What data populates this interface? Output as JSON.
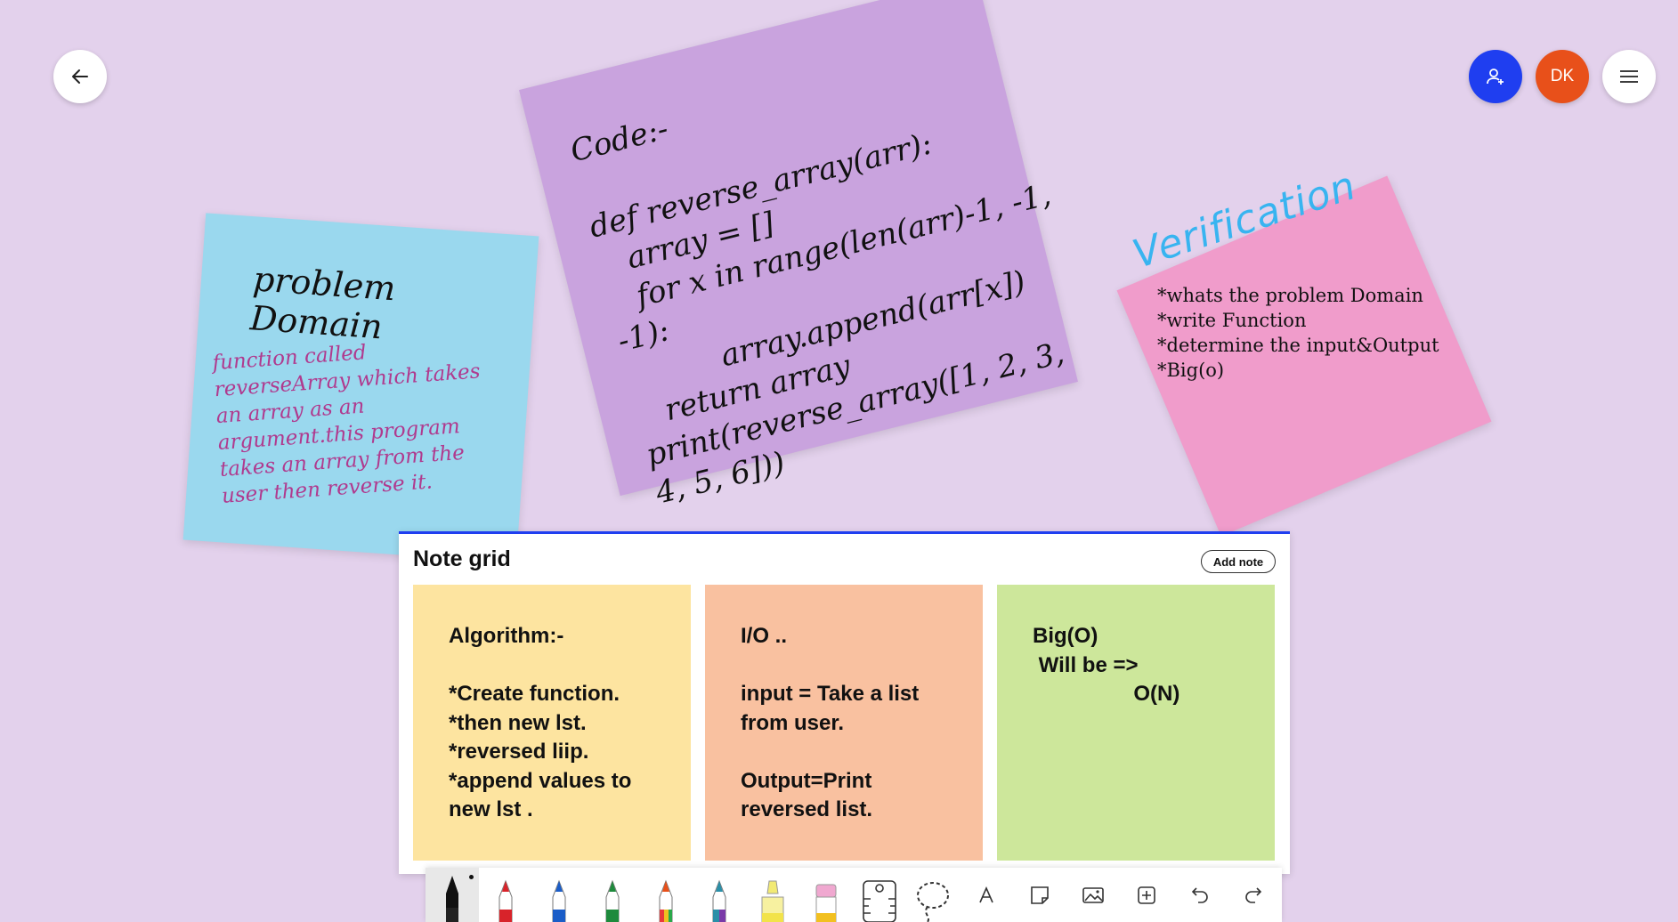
{
  "top_bar": {
    "back_icon": "arrow-left-icon",
    "share_icon": "add-person-icon",
    "avatar_initials": "DK",
    "menu_icon": "hamburger-menu-icon"
  },
  "colors": {
    "background": "#e3d1ec",
    "accent_blue": "#1f3ef0",
    "avatar_orange": "#e8501a",
    "note_blue": "#9ad8ee",
    "note_purple": "#c9a3de",
    "note_pink": "#f09ccb",
    "card_yellow": "#fde4a0",
    "card_orange": "#f9c1a0",
    "card_green": "#cde79b"
  },
  "canvas": {
    "problem_note": {
      "title": "problem Domain",
      "body": "function called reverseArray which takes an array as an argument.this program takes an array from the user then reverse it."
    },
    "code_note": {
      "text": "Code:-\n\ndef reverse_array(arr):\n   array = []\n   for x in range(len(arr)-1, -1,\n-1):\n          array.append(arr[x])\n   return array\nprint(reverse_array([1, 2, 3,\n4, 5, 6]))"
    },
    "verification": {
      "label": "Verification",
      "items": [
        "*whats the problem Domain",
        "*write Function",
        "*determine the input&Output",
        "*Big(o)"
      ]
    }
  },
  "note_grid": {
    "title": "Note grid",
    "add_label": "Add note",
    "cards": [
      {
        "text": "Algorithm:-\n\n*Create function.\n*then new lst.\n*reversed liip.\n*append values to\nnew lst ."
      },
      {
        "text": "I/O ..\n\ninput = Take a list\nfrom user.\n\nOutput=Print\nreversed list."
      },
      {
        "text": "Big(O)\n Will be =>\n                 O(N)"
      }
    ]
  },
  "toolbar": {
    "tools": [
      "black-pen-icon",
      "red-pen-icon",
      "blue-pen-icon",
      "green-pen-icon",
      "rainbow-pen-icon",
      "galaxy-pen-icon",
      "highlighter-icon",
      "eraser-icon",
      "ruler-icon",
      "lasso-icon",
      "text-icon",
      "sticky-note-icon",
      "image-icon",
      "add-icon",
      "undo-icon",
      "redo-icon"
    ]
  }
}
